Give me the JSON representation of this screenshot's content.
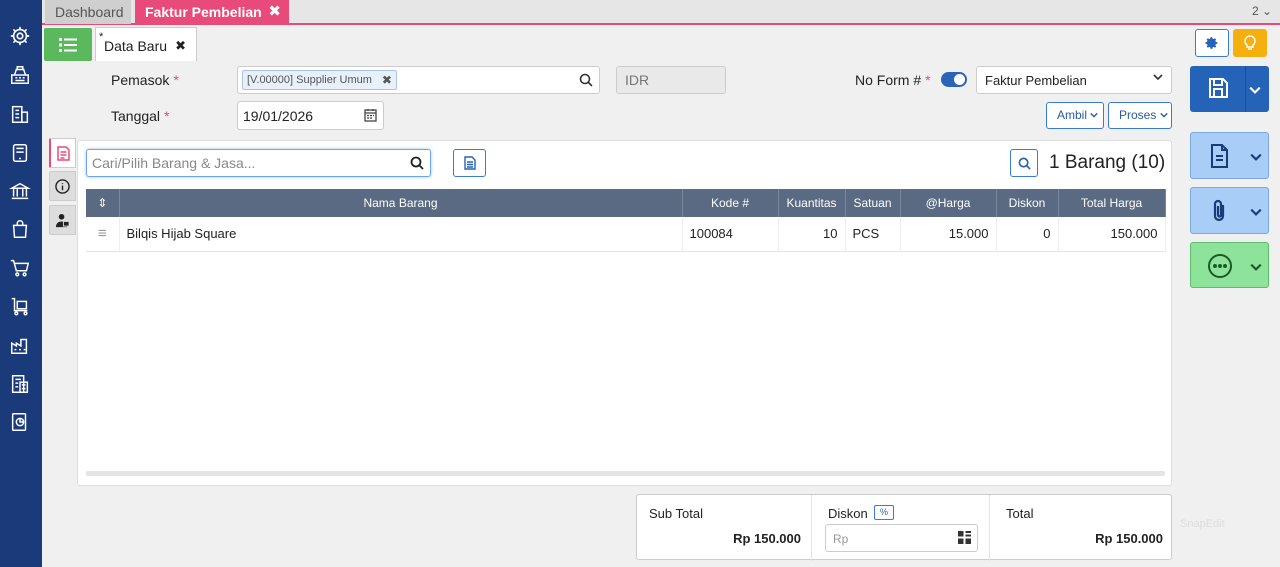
{
  "tabs": {
    "dashboard": "Dashboard",
    "faktur": "Faktur Pembelian",
    "close": "✖",
    "count": "2 ⌄"
  },
  "doc_tab": {
    "star": "*",
    "label": "Data Baru",
    "close": "✖"
  },
  "form": {
    "pemasok_label": "Pemasok",
    "required_mark": "*",
    "supplier_chip": "[V.00000] Supplier Umum",
    "chip_remove": "✖",
    "currency": "IDR",
    "no_form_label": "No Form #",
    "form_type": "Faktur Pembelian",
    "tanggal_label": "Tanggal",
    "date": "19/01/2026",
    "ambil_label": "Ambil",
    "proses_label": "Proses"
  },
  "items": {
    "search_placeholder": "Cari/Pilih Barang & Jasa...",
    "count": "1 Barang (10)",
    "sort_glyph": "⇕",
    "columns": [
      "Nama Barang",
      "Kode #",
      "Kuantitas",
      "Satuan",
      "@Harga",
      "Diskon",
      "Total Harga"
    ],
    "rows": [
      {
        "handle": "≡",
        "name": "Bilqis Hijab Square",
        "code": "100084",
        "qty": "10",
        "unit": "PCS",
        "price": "15.000",
        "discount": "0",
        "total": "150.000"
      }
    ]
  },
  "totals": {
    "subtotal_label": "Sub Total",
    "subtotal_value": "Rp 150.000",
    "diskon_label": "Diskon",
    "pct_label": "%",
    "diskon_placeholder": "Rp",
    "total_label": "Total",
    "total_value": "Rp 150.000"
  },
  "watermark": "SnapEdit",
  "colors": {
    "sidebar": "#1b3a7a",
    "accent_pink": "#e84a7a",
    "primary_blue": "#2463b8",
    "success_green": "#5cb85c",
    "warning_yellow": "#f5b00f"
  },
  "sidebar_icons": [
    "gear-icon",
    "cash-register-icon",
    "building-icon",
    "tablet-icon",
    "bank-icon",
    "shopping-bag-icon",
    "cart-icon",
    "delivery-cart-icon",
    "factory-icon",
    "tax-calculator-icon",
    "report-icon"
  ]
}
